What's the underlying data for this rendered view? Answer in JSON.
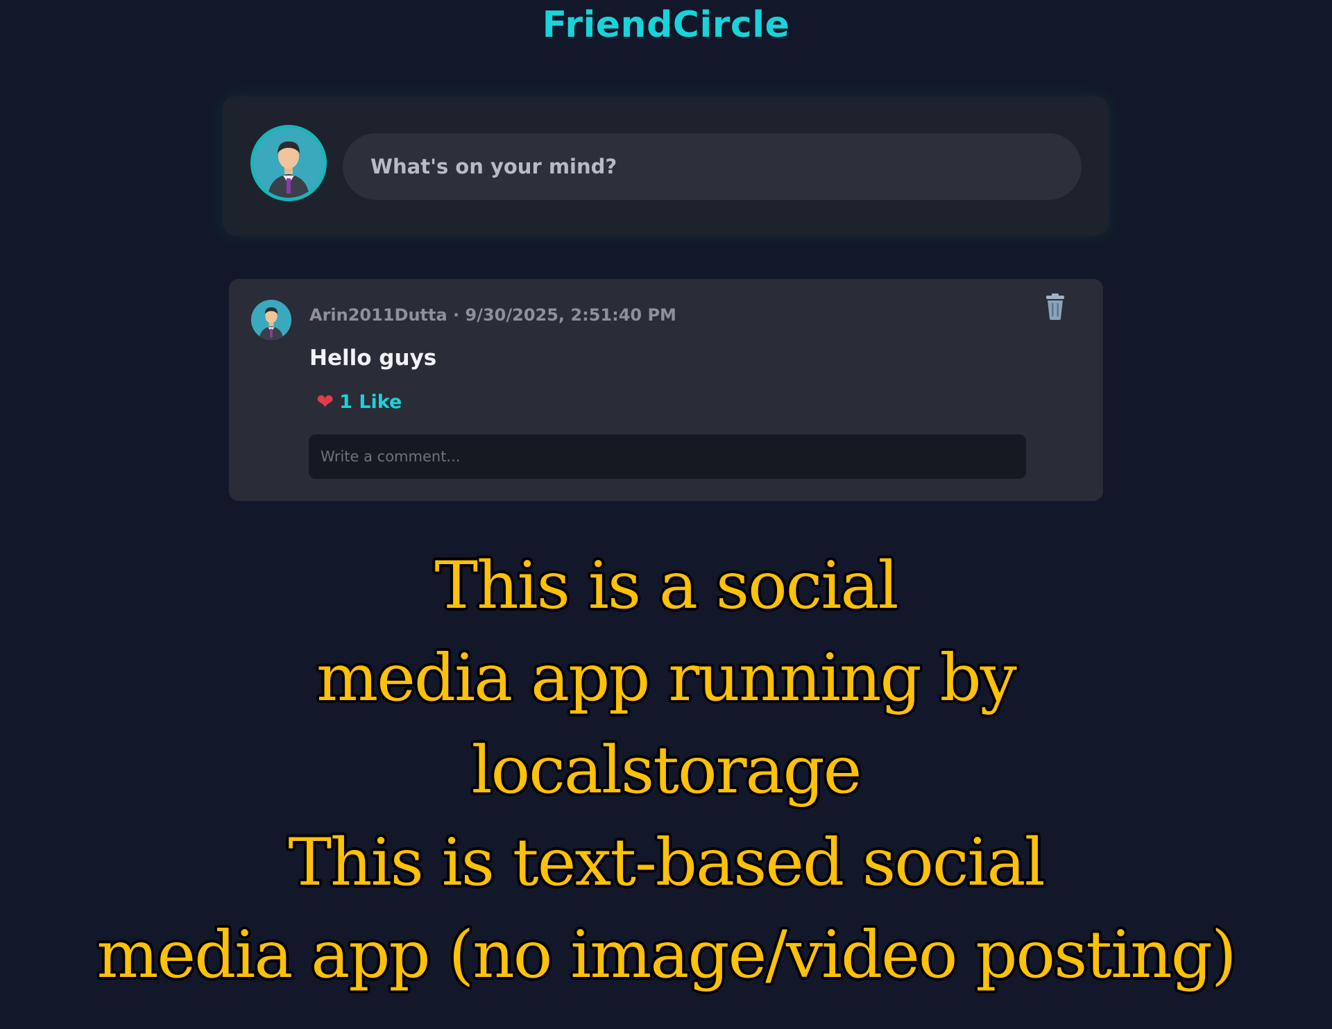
{
  "app": {
    "title": "FriendCircle"
  },
  "composer": {
    "placeholder": "What's on your mind?"
  },
  "post": {
    "meta": "Arin2011Dutta · 9/30/2025, 2:51:40 PM",
    "text": "Hello guys",
    "likes_label": "1 Like",
    "comment_placeholder": "Write a comment..."
  },
  "caption": {
    "lines": [
      "This is a social",
      "media app running by",
      "localstorage",
      "This is text-based social",
      "media app (no image/video posting)"
    ]
  },
  "icons": {
    "like": "heart-icon",
    "delete": "trash-icon",
    "avatar": "user-avatar-icon"
  },
  "colors": {
    "background": "#121829",
    "accent": "#19d3da",
    "card": "#2a2d37",
    "caption": "#ffc107",
    "heart": "#e23b4a"
  }
}
